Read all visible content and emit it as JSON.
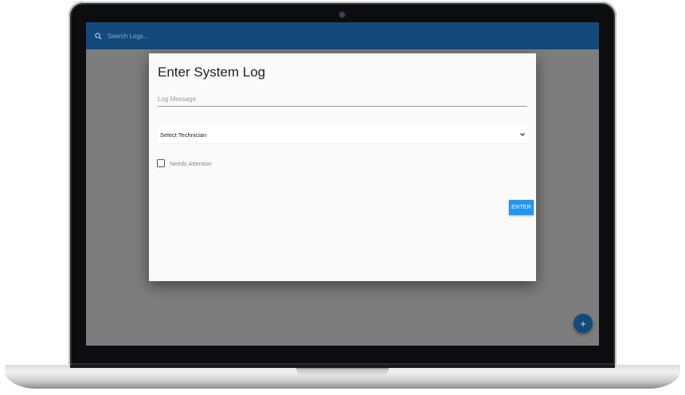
{
  "search": {
    "placeholder": "Search Logs..."
  },
  "dialog": {
    "title": "Enter System Log",
    "log_message": {
      "placeholder": "Log Message",
      "value": ""
    },
    "technician_select": {
      "selected": "Select Technician"
    },
    "needs_attention": {
      "label": "Needs Attention",
      "checked": false
    },
    "enter_label": "ENTER"
  },
  "fab": {
    "label": "+"
  },
  "icons": {
    "search": "search-icon",
    "dropdown": "chevron-down-icon",
    "add": "plus-icon"
  },
  "colors": {
    "topbar": "#124a7c",
    "accent": "#2196f3",
    "overlay": "#7d7d7d",
    "dialog_bg": "#fafafa"
  }
}
